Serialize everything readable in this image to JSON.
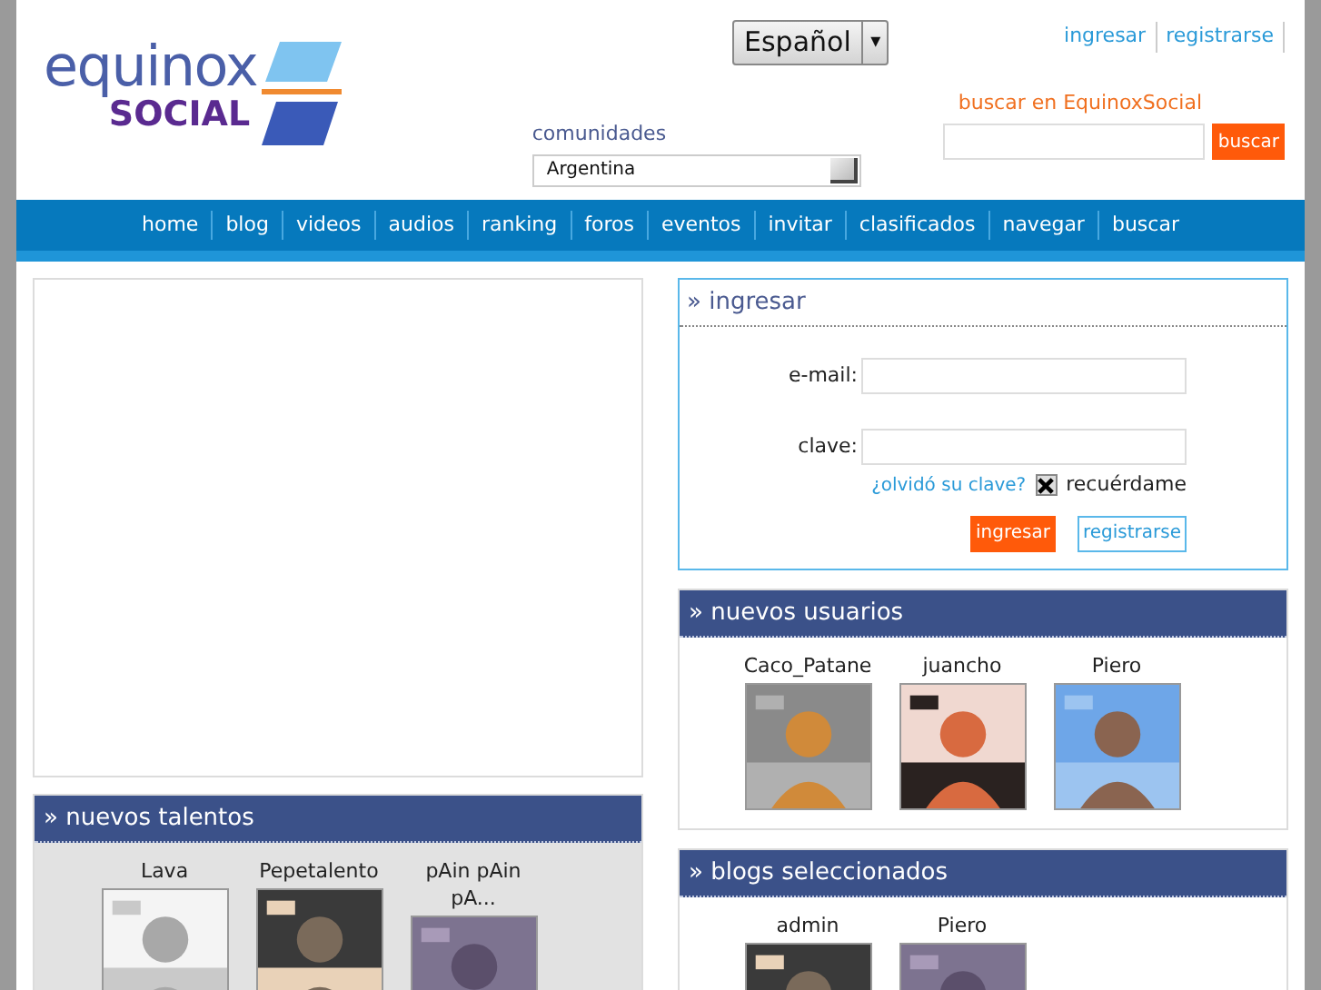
{
  "logo": {
    "word": "equinox",
    "subword": "SOCIAL"
  },
  "language": {
    "value": "Español",
    "caret": "▾"
  },
  "top_links": [
    "ingresar",
    "registrarse"
  ],
  "communities": {
    "label": "comunidades",
    "value": "Argentina"
  },
  "search": {
    "label": "buscar en EquinoxSocial",
    "button": "buscar"
  },
  "nav": [
    "home",
    "blog",
    "videos",
    "audios",
    "ranking",
    "foros",
    "eventos",
    "invitar",
    "clasificados",
    "navegar",
    "buscar"
  ],
  "login": {
    "title": "ingresar",
    "email_label": "e-mail:",
    "password_label": "clave:",
    "forgot": "¿olvidó su clave?",
    "remember": {
      "label": "recuérdame",
      "checked": true
    },
    "submit": "ingresar",
    "register": "registrarse"
  },
  "talents": {
    "title": "nuevos talentos",
    "items": [
      {
        "name": "Lava",
        "kind": "picture"
      },
      {
        "name": "Pepetalento",
        "kind": "picture"
      },
      {
        "name": "pAin pAin pA...",
        "kind": "picture"
      }
    ]
  },
  "new_users": {
    "title": "nuevos usuarios",
    "items": [
      {
        "name": "Caco_Patane",
        "kind": "picture"
      },
      {
        "name": "juancho",
        "kind": "picture"
      },
      {
        "name": "Piero",
        "kind": "picture"
      }
    ]
  },
  "blogs": {
    "title": "blogs seleccionados",
    "items": [
      {
        "name": "admin",
        "kind": "picture"
      },
      {
        "name": "Piero",
        "kind": "picture"
      }
    ]
  },
  "section_marker": "»"
}
